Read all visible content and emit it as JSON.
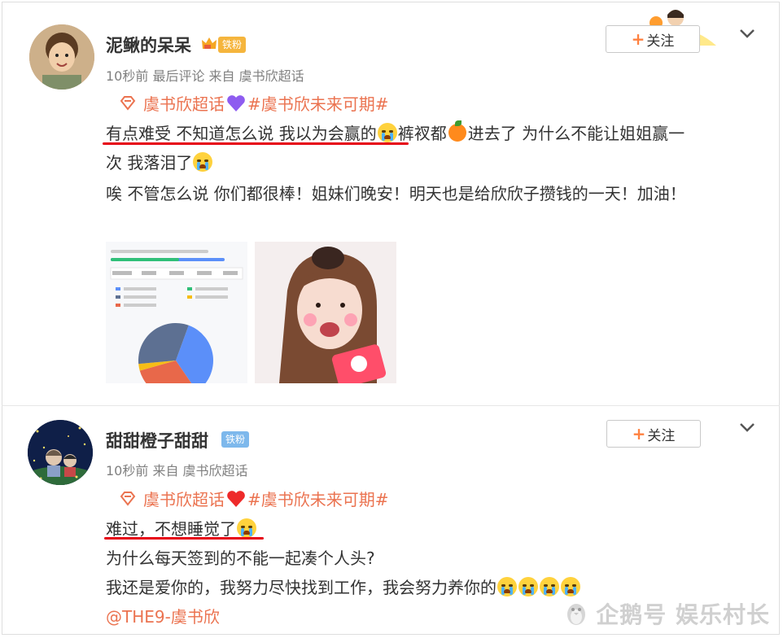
{
  "posts": [
    {
      "username": "泥鳅的呆呆",
      "fan_badge": "铁粉",
      "meta": "10秒前  最后评论  来自  虞书欣超话",
      "follow_label": "关注",
      "topic_name": "虞书欣超话",
      "topic_tag": "#虞书欣未来可期#",
      "line1_a": "有点难受 不知道怎么说 我以为会赢的",
      "line1_b": "裤衩都",
      "line1_c": "进去了 为什么不能让姐姐赢一",
      "line2": "次 我落泪了",
      "line3": "唉 不管怎么说 你们都很棒！姐妹们晚安！明天也是给欣欣子攒钱的一天！加油！"
    },
    {
      "username": "甜甜橙子甜甜",
      "fan_badge": "铁粉",
      "meta": "10秒前  来自  虞书欣超话",
      "follow_label": "关注",
      "topic_name": "虞书欣超话",
      "topic_tag": "#虞书欣未来可期#",
      "line1": "难过，不想睡觉了",
      "line2": "为什么每天签到的不能一起凑个人头?",
      "line3": "我还是爱你的，我努力尽快找到工作，我会努力养你的",
      "mention": "@THE9-虞书欣"
    }
  ],
  "pie_chart_data": {
    "type": "pie",
    "slices": [
      {
        "label": "虞书欣%",
        "value": 34.87,
        "color": "#5b8ff9"
      },
      {
        "label": "其他",
        "value": 30.2,
        "color": "#e8684a"
      },
      {
        "label": "",
        "value": 2.95,
        "color": "#f6bd16"
      },
      {
        "label": "",
        "value": 31.98,
        "color": "#5d7092"
      }
    ]
  },
  "watermark": "企鹅号 娱乐村长",
  "colors": {
    "accent": "#eb7350",
    "underline": "#e60012",
    "badge_gold": "#f5b53d",
    "badge_blue": "#7db8ec"
  }
}
